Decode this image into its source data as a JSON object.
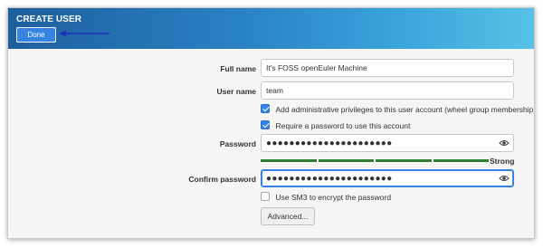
{
  "header": {
    "title": "CREATE USER",
    "done_label": "Done"
  },
  "form": {
    "full_name": {
      "label": "Full name",
      "value": "It's FOSS openEuler Machine"
    },
    "user_name": {
      "label": "User name",
      "value": "team"
    },
    "admin_checkbox": {
      "label": "Add administrative privileges to this user account (wheel group membership)",
      "checked": true
    },
    "require_password_checkbox": {
      "label": "Require a password to use this account",
      "checked": true
    },
    "password": {
      "label": "Password",
      "masked_value": "●●●●●●●●●●●●●●●●●●●●●●"
    },
    "strength": {
      "label": "Strong",
      "level": 1.0,
      "color": "#2e7d32"
    },
    "confirm_password": {
      "label": "Confirm password",
      "masked_value": "●●●●●●●●●●●●●●●●●●●●●●"
    },
    "sm3_checkbox": {
      "label": "Use SM3 to encrypt the password",
      "checked": false
    },
    "advanced_label": "Advanced..."
  },
  "colors": {
    "accent": "#3584e4",
    "header_gradient_start": "#1e5f9e",
    "header_gradient_end": "#57c1e6",
    "annotation_arrow": "#1f2fb8"
  },
  "icons": {
    "password_visibility": "eye-icon",
    "checkbox_checked": "check-icon",
    "annotation": "arrow-left-icon"
  }
}
